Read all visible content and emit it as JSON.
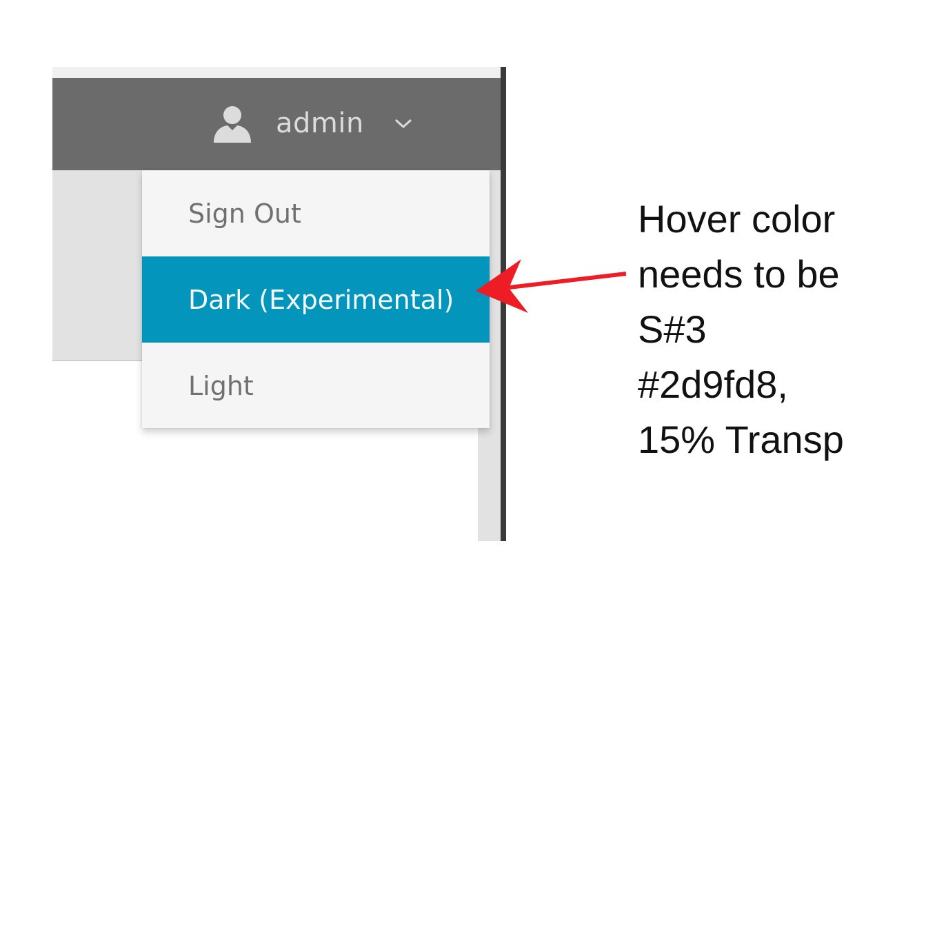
{
  "header": {
    "username": "admin",
    "user_icon": "user-icon",
    "dropdown_icon": "chevron-down-icon"
  },
  "dropdown": {
    "items": [
      {
        "label": "Sign Out",
        "highlighted": false
      },
      {
        "label": "Dark (Experimental)",
        "highlighted": true
      },
      {
        "label": "Light",
        "highlighted": false
      }
    ]
  },
  "annotation": {
    "lines": [
      "Hover color",
      "needs to be",
      "S#3",
      "#2d9fd8,",
      "15% Transp"
    ],
    "arrow_color": "#ee1c24"
  },
  "colors": {
    "navbar": "#6b6b6b",
    "highlight": "#0395bb",
    "dropdown_bg": "#f5f5f5",
    "content_bg": "#e2e2e2"
  }
}
